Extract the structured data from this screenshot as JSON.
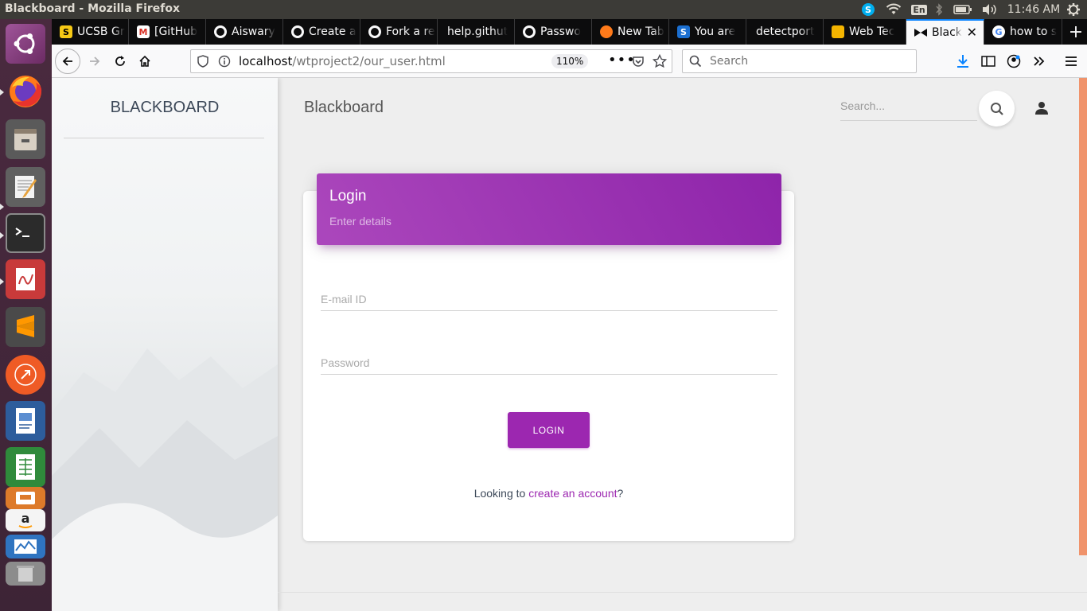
{
  "os": {
    "window_title": "Blackboard - Mozilla Firefox",
    "keyboard_layout": "En",
    "clock": "11:46 AM",
    "launcher_icons": [
      "ubuntu-dash-icon",
      "firefox-icon",
      "files-icon",
      "text-editor-icon",
      "terminal-icon",
      "document-viewer-icon",
      "sublime-text-icon",
      "postman-icon",
      "libreoffice-impress-icon",
      "libreoffice-calc-icon",
      "software-center-icon",
      "amazon-icon",
      "system-monitor-icon",
      "trash-icon"
    ]
  },
  "browser": {
    "tabs": [
      {
        "title": "UCSB Gr",
        "icon": "yellow-favicon"
      },
      {
        "title": "[GitHub",
        "icon": "gmail-icon"
      },
      {
        "title": "Aiswary",
        "icon": "github-icon"
      },
      {
        "title": "Create a",
        "icon": "github-icon"
      },
      {
        "title": "Fork a re",
        "icon": "github-icon"
      },
      {
        "title": "help.githut",
        "icon": "none"
      },
      {
        "title": "Passwo",
        "icon": "github-icon"
      },
      {
        "title": "New Tab",
        "icon": "firefox-icon"
      },
      {
        "title": "You are",
        "icon": "s-favicon"
      },
      {
        "title": "detectport",
        "icon": "none"
      },
      {
        "title": "Web Tec",
        "icon": "slides-icon"
      },
      {
        "title": "Black",
        "icon": "bow-icon",
        "active": true
      },
      {
        "title": "how to s",
        "icon": "google-icon"
      }
    ],
    "url_host": "localhost",
    "url_path": "/wtproject2/our_user.html",
    "zoom": "110%",
    "search_placeholder": "Search"
  },
  "page": {
    "sidebar_brand": "BLACKBOARD",
    "nav_title": "Blackboard",
    "search_placeholder": "Search...",
    "login": {
      "title": "Login",
      "subtitle": "Enter details",
      "email_placeholder": "E-mail ID",
      "password_placeholder": "Password",
      "button": "LOGIN",
      "signup_prefix": "Looking to ",
      "signup_link": "create an account",
      "signup_suffix": "?"
    }
  },
  "colors": {
    "accent": "#9c27b0",
    "header_gradient_start": "#ab47bc",
    "header_gradient_end": "#8e24aa",
    "scroll_accent": "#f0936b"
  }
}
